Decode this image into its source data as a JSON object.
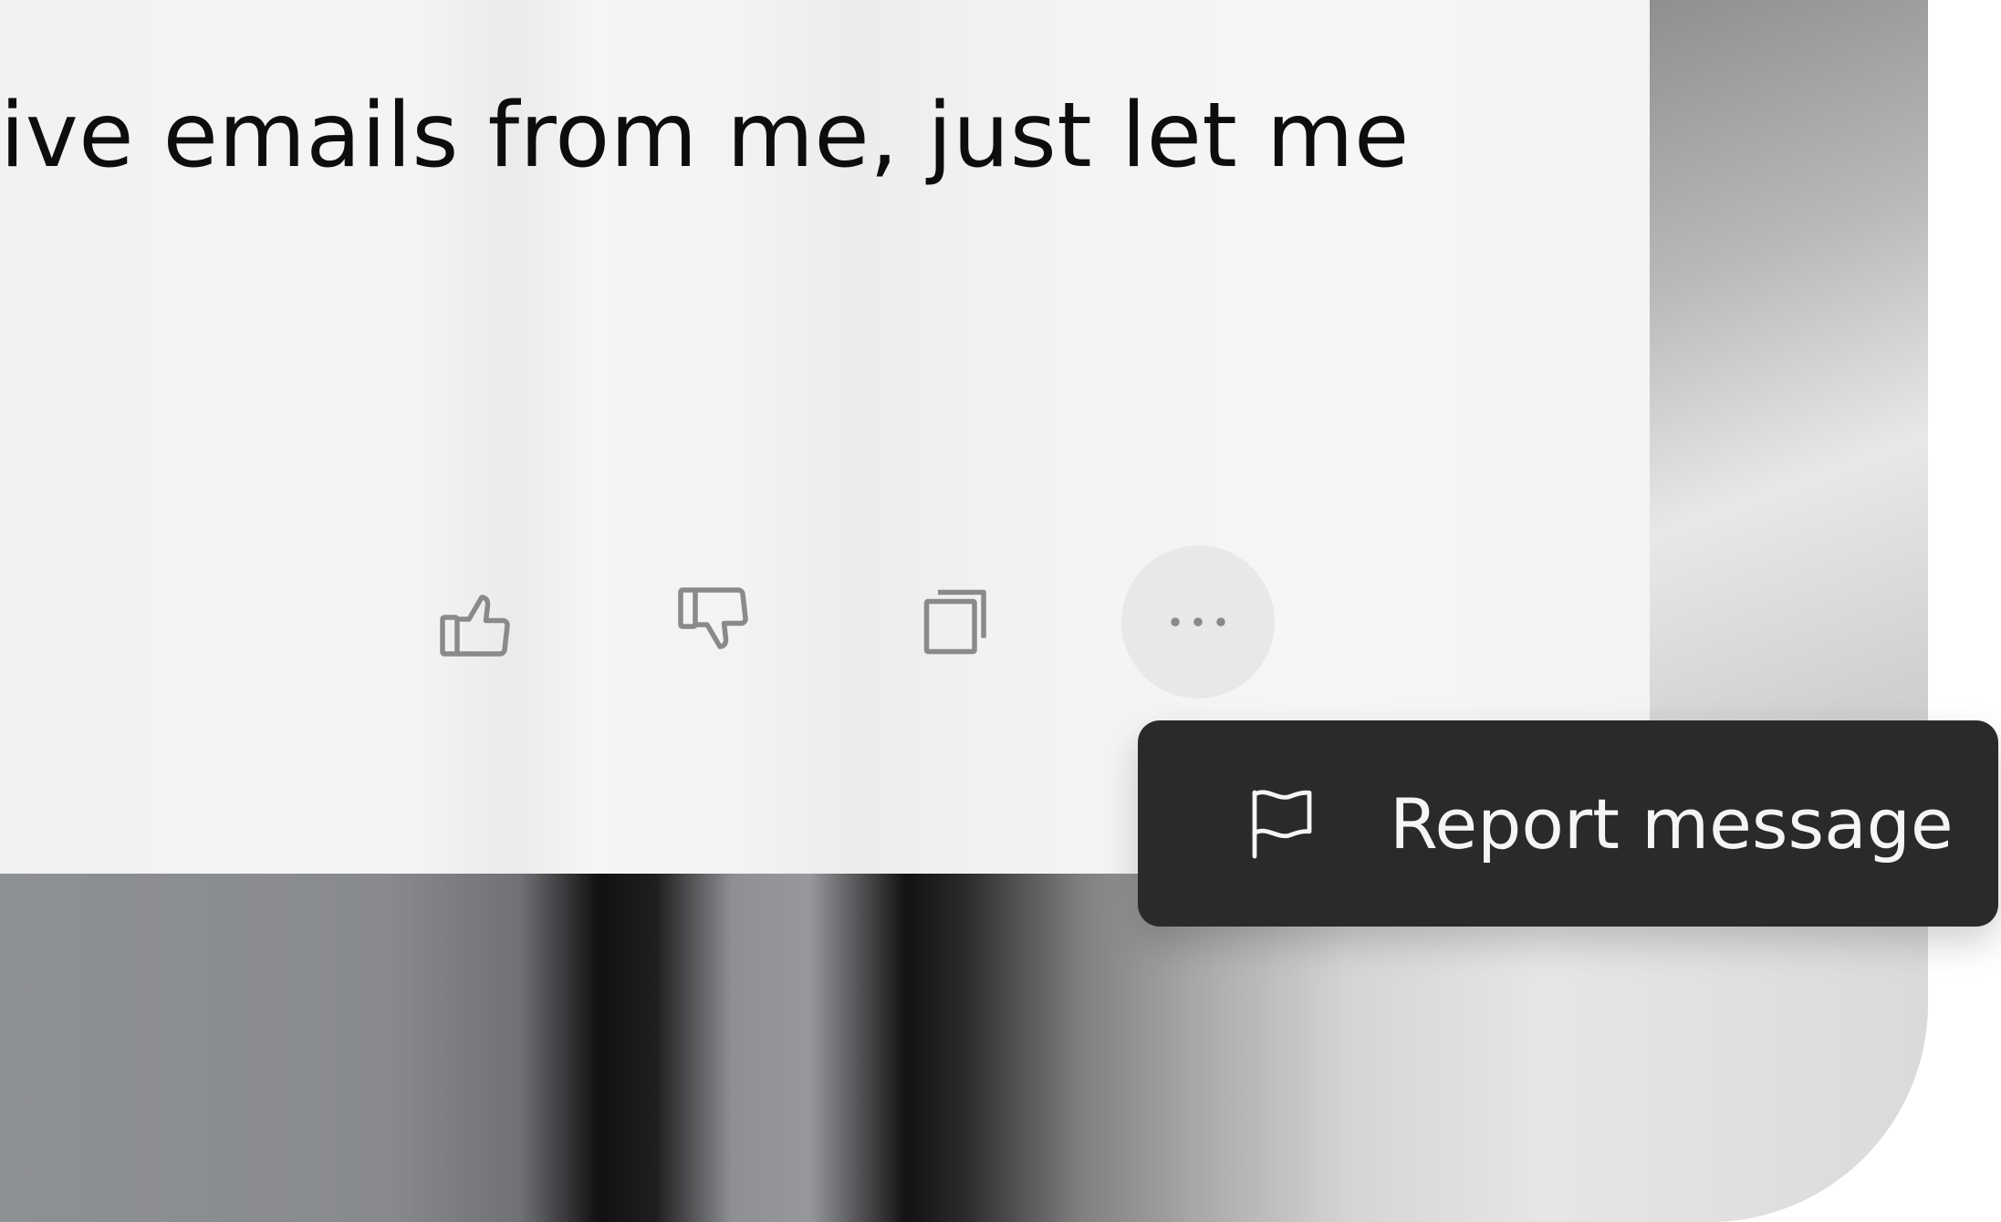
{
  "message": {
    "text": "ive emails from me, just let me"
  },
  "actions": {
    "thumbs_up_icon": "thumbs-up-icon",
    "thumbs_down_icon": "thumbs-down-icon",
    "copy_icon": "copy-icon",
    "more_icon": "more-horizontal-icon",
    "more_label": "•••"
  },
  "menu": {
    "items": [
      {
        "icon": "flag-icon",
        "label": "Report message"
      }
    ]
  },
  "colors": {
    "icon": "#8a8a8a",
    "menu_bg": "#2b2a29",
    "menu_text": "#f5f5f5",
    "text": "#0d0d0d"
  }
}
